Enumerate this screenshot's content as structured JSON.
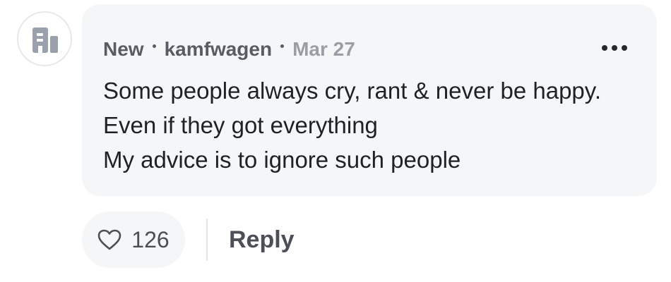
{
  "comment": {
    "avatar_icon": "building-icon",
    "badge": "New",
    "username": "kamfwagen",
    "date": "Mar 27",
    "more_icon": "more-options-icon",
    "lines": [
      "Some people always cry, rant & never be happy.",
      "Even if they got everything",
      "My advice is to ignore such people"
    ]
  },
  "actions": {
    "like_icon": "heart-icon",
    "like_count": "126",
    "reply_label": "Reply"
  },
  "colors": {
    "bubble_bg": "#f5f6f8",
    "text_primary": "#1f2125",
    "text_secondary": "#595c63",
    "text_muted": "#9a9da4"
  }
}
